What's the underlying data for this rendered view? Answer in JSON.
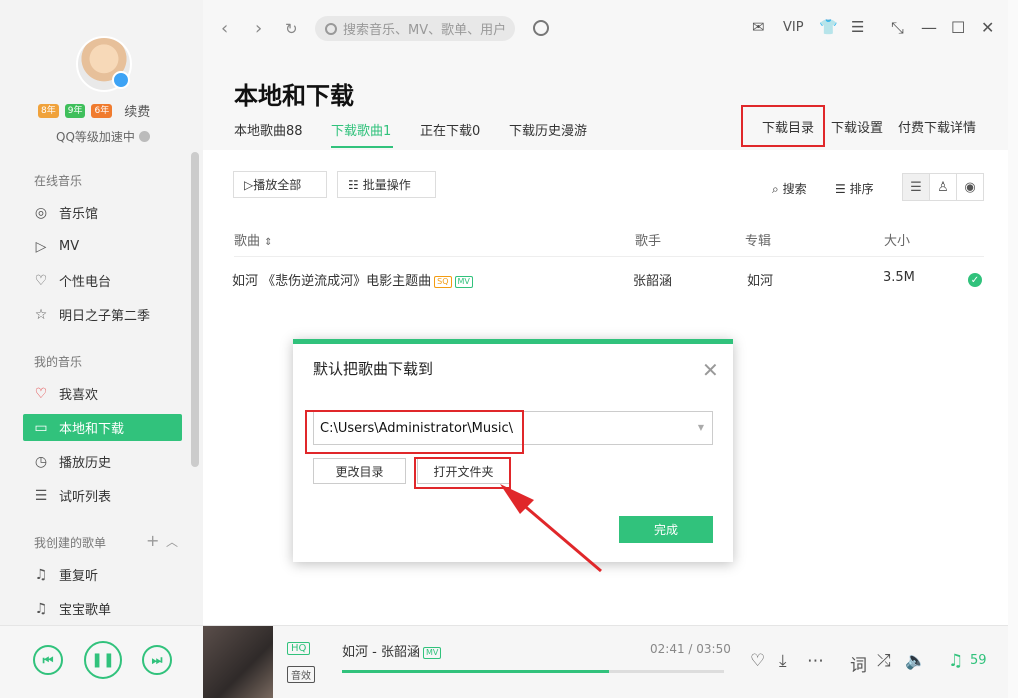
{
  "sidebar": {
    "vip_tags": [
      "8年",
      "9年",
      "6年"
    ],
    "renew": "续费",
    "qq_speed": "QQ等级加速中",
    "sections": {
      "online": "在线音乐",
      "mine": "我的音乐",
      "created": "我创建的歌单"
    },
    "online_items": [
      {
        "label": "音乐馆",
        "icon": "music-hall-icon"
      },
      {
        "label": "MV",
        "icon": "mv-icon"
      },
      {
        "label": "个性电台",
        "icon": "radio-heart-icon"
      },
      {
        "label": "明日之子第二季",
        "icon": "star-icon"
      }
    ],
    "mine_items": [
      {
        "label": "我喜欢",
        "icon": "heart-icon"
      },
      {
        "label": "本地和下载",
        "icon": "monitor-icon",
        "active": true
      },
      {
        "label": "播放历史",
        "icon": "clock-icon"
      },
      {
        "label": "试听列表",
        "icon": "list-icon"
      }
    ],
    "playlists": [
      {
        "label": "重复听",
        "icon": "note-icon"
      },
      {
        "label": "宝宝歌单",
        "icon": "note-icon"
      }
    ]
  },
  "topbar": {
    "search_placeholder": "搜索音乐、MV、歌单、用户",
    "vip": "VIP"
  },
  "page": {
    "title": "本地和下载",
    "tabs": [
      {
        "label": "本地歌曲88"
      },
      {
        "label": "下载歌曲1",
        "active": true
      },
      {
        "label": "正在下载0"
      },
      {
        "label": "下载历史漫游"
      }
    ],
    "right_links": [
      "下载目录",
      "下载设置",
      "付费下载详情"
    ],
    "play_all": "▷播放全部",
    "batch": "批量操作",
    "search": "搜索",
    "sort": "排序"
  },
  "table": {
    "headers": [
      "歌曲",
      "歌手",
      "专辑",
      "大小"
    ],
    "rows": [
      {
        "song": "如河 《悲伤逆流成河》电影主题曲",
        "tags": [
          "SQ",
          "MV"
        ],
        "singer": "张韶涵",
        "album": "如河",
        "size": "3.5M"
      }
    ]
  },
  "dialog": {
    "title": "默认把歌曲下载到",
    "path": "C:\\Users\\Administrator\\Music\\",
    "change_dir": "更改目录",
    "open_folder": "打开文件夹",
    "done": "完成"
  },
  "player": {
    "quality": "HQ",
    "effect": "音效",
    "song": "如河 - 张韶涵",
    "mv_tag": "MV",
    "time": "02:41 / 03:50",
    "progress": 0.7,
    "playlist_count": "59"
  },
  "colors": {
    "accent": "#31c27c",
    "highlight": "#e0272a"
  }
}
